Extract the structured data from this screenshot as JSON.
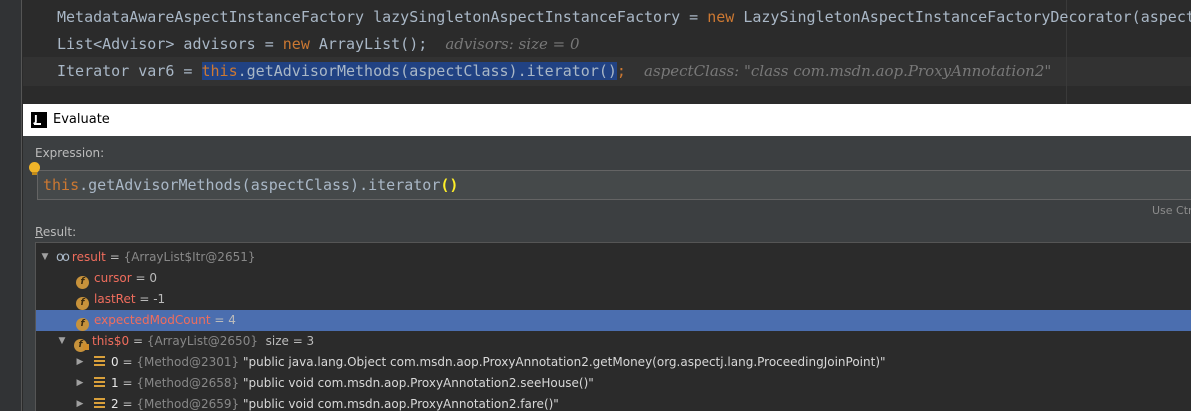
{
  "editor": {
    "line1": {
      "type": "MetadataAwareAspectInstanceFactory",
      "var": "lazySingletonAspectInstanceFactory",
      "op": "=",
      "kw": "new",
      "rest": "LazySingletonAspectInstanceFactoryDecorator(aspect"
    },
    "line2": {
      "decl": "List<Advisor> advisors =",
      "kw": "new",
      "rest": "ArrayList();",
      "hint": "advisors:  size = 0"
    },
    "line3": {
      "decl": "Iterator var6 =",
      "kw": "this",
      "selected": ".getAdvisorMethods(aspectClass).iterator()",
      "semi": ";",
      "hint": "aspectClass: \"class com.msdn.aop.ProxyAnnotation2\""
    }
  },
  "dialog": {
    "title": "Evaluate",
    "app_icon": "intellij-icon",
    "expression_label": "Expression:",
    "expression": {
      "kw": "this",
      "text": ".getAdvisorMethods(aspectClass).iterator",
      "parens": "()"
    },
    "shortcut_hint": "Use Ctrl",
    "result_label_underlined": "R",
    "result_label_rest": "esult:",
    "tree": [
      {
        "icon": "watch-infinity-icon",
        "name": "result",
        "eq": " = ",
        "value": "{ArrayList$Itr@2651}",
        "extra": ""
      },
      {
        "icon": "field-icon",
        "name": "cursor",
        "eq": " = ",
        "value": "0",
        "extra": ""
      },
      {
        "icon": "field-icon",
        "name": "lastRet",
        "eq": " = ",
        "value": "-1",
        "extra": ""
      },
      {
        "icon": "field-icon",
        "name": "expectedModCount",
        "eq": " = ",
        "value": "4",
        "extra": ""
      },
      {
        "icon": "field-icon",
        "name": "this$0",
        "eq": " = ",
        "value": "{ArrayList@2650}",
        "extra": "size = 3"
      },
      {
        "icon": "list-element-icon",
        "name": "0",
        "eq": " = ",
        "value": "{Method@2301}",
        "extra": "\"public java.lang.Object com.msdn.aop.ProxyAnnotation2.getMoney(org.aspectj.lang.ProceedingJoinPoint)\""
      },
      {
        "icon": "list-element-icon",
        "name": "1",
        "eq": " = ",
        "value": "{Method@2658}",
        "extra": "\"public void com.msdn.aop.ProxyAnnotation2.seeHouse()\""
      },
      {
        "icon": "list-element-icon",
        "name": "2",
        "eq": " = ",
        "value": "{Method@2659}",
        "extra": "\"public void com.msdn.aop.ProxyAnnotation2.fare()\""
      }
    ]
  },
  "colors": {
    "editor_bg": "#2b2b2b",
    "keyword": "#cc7832",
    "selection": "#214283",
    "tree_selection": "#4b6eaf",
    "field_name": "#f06d5d"
  }
}
